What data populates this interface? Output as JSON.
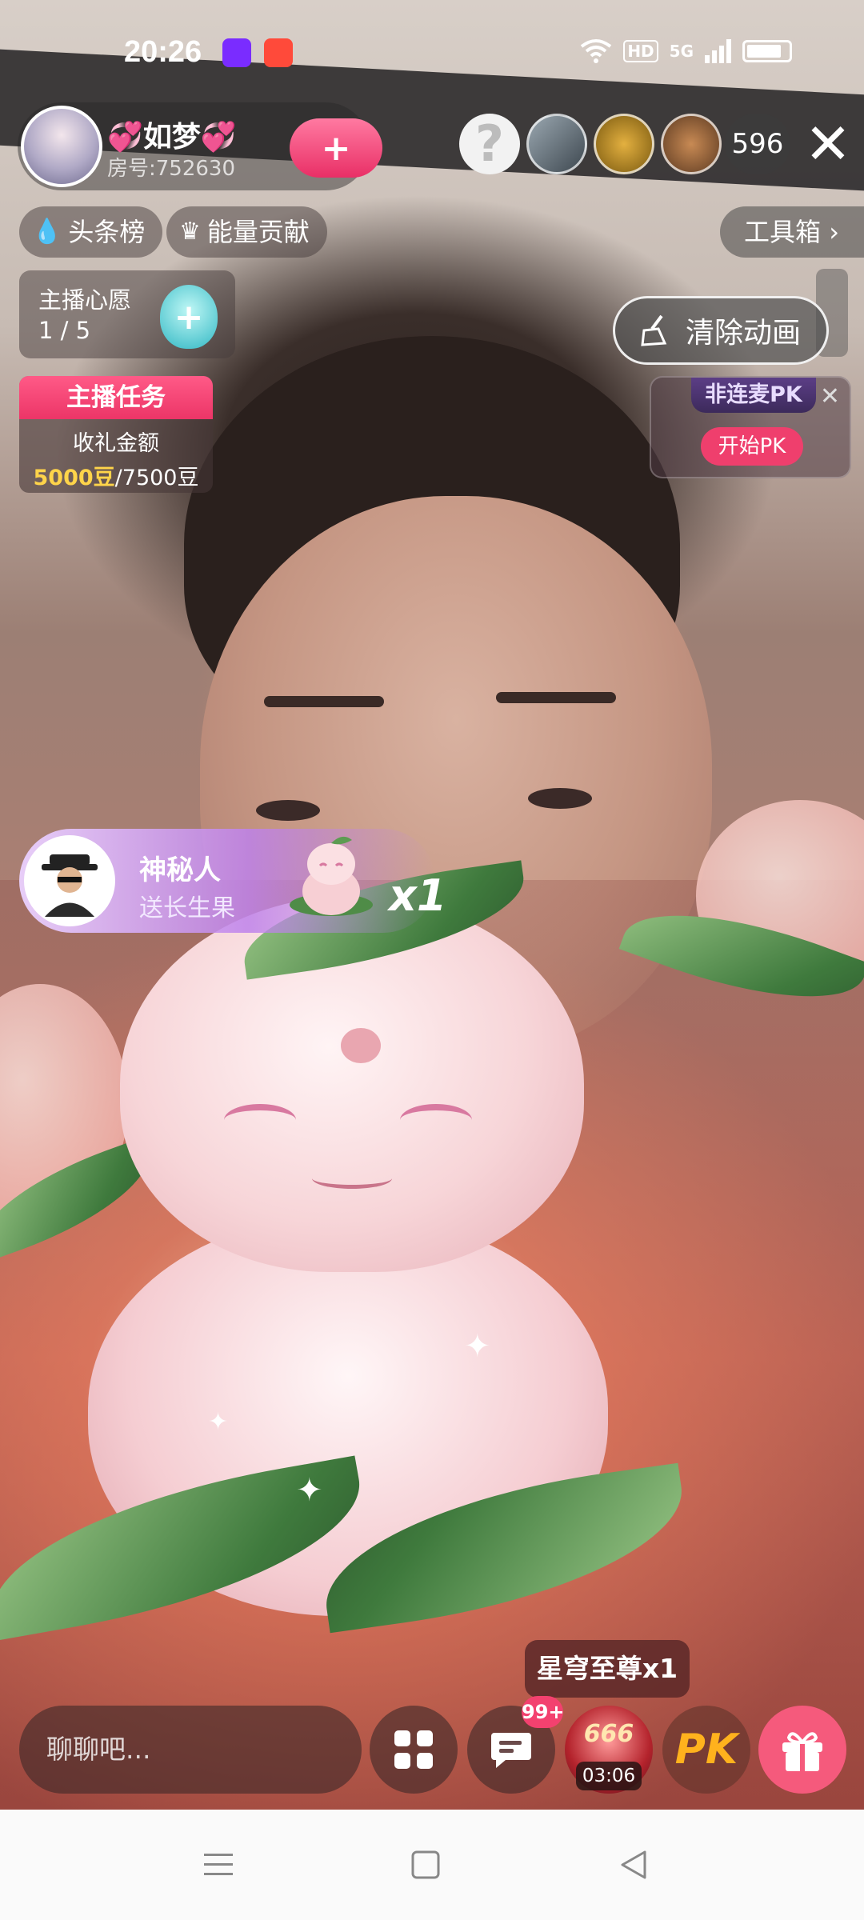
{
  "status_bar": {
    "time": "20:26",
    "hd": "HD",
    "network": "5G",
    "icons": [
      "wifi-icon",
      "hd-icon",
      "signal-icon",
      "battery-icon"
    ]
  },
  "host": {
    "name": "💞如梦💞",
    "room_number": "房号:752630",
    "follow_symbol": "+"
  },
  "header_right": {
    "help_symbol": "?",
    "viewer_count": "596",
    "close_symbol": "✕"
  },
  "chips": {
    "headline_rank": "头条榜",
    "energy_contribution": "能量贡献",
    "toolbox": "工具箱"
  },
  "wish": {
    "title": "主播心愿",
    "progress": "1 / 5"
  },
  "task": {
    "header": "主播任务",
    "label": "收礼金额",
    "current": "5000豆",
    "target": "/7500豆"
  },
  "clear_animation": "清除动画",
  "pk_card": {
    "tag": "非连麦PK",
    "start": "开始PK"
  },
  "gift_banner": {
    "sender": "神秘人",
    "description": "送长生果",
    "count": "x1"
  },
  "combo_tip": "星穹至尊x1",
  "bottom_bar": {
    "chat_placeholder": "聊聊吧...",
    "message_badge": "99+",
    "level_number": "666",
    "level_timer": "03:06",
    "pk_label": "PK"
  },
  "colors": {
    "accent_pink": "#ef3f6d",
    "gold": "#ffd44a",
    "nav_background": "#fafafa"
  }
}
